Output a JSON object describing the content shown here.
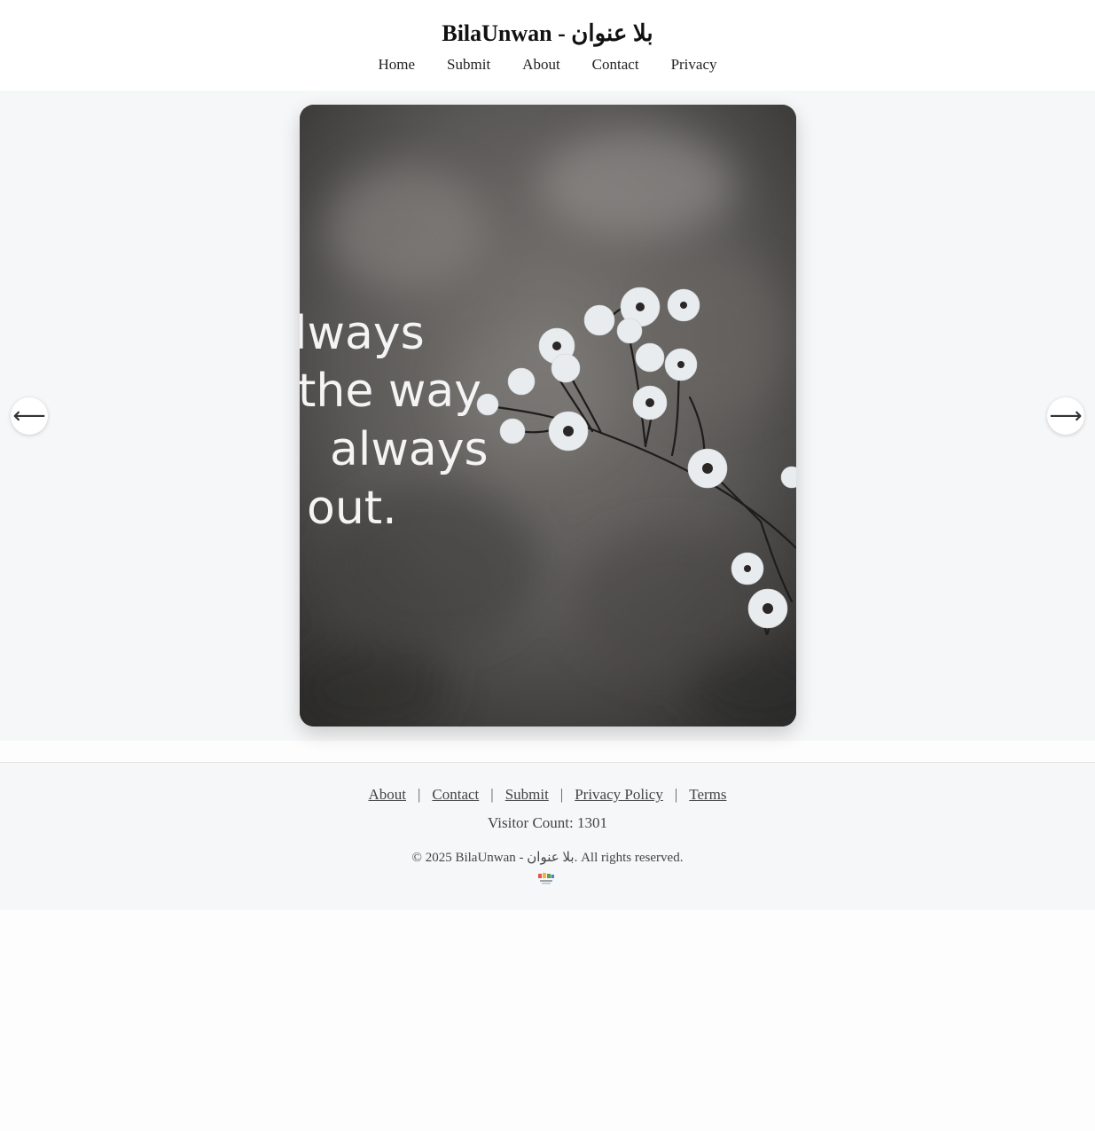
{
  "header": {
    "site_title": "BilaUnwan - بلا عنوان",
    "nav": [
      "Home",
      "Submit",
      "About",
      "Contact",
      "Privacy"
    ]
  },
  "gallery": {
    "prev_arrow": "⟵",
    "next_arrow": "⟶",
    "photo": {
      "quote_lines": [
        "lways",
        "the way",
        "always",
        "out."
      ]
    }
  },
  "footer": {
    "links": [
      "About",
      "Contact",
      "Submit",
      "Privacy Policy",
      "Terms"
    ],
    "separator": "|",
    "visitor_count": "Visitor Count: 1301",
    "copyright": "© 2025 BilaUnwan - بلا عنوان. All rights reserved."
  },
  "colors": {
    "page_bg": "#fdfdfd",
    "gallery_bg": "#f6f7f8",
    "text": "#333333"
  }
}
